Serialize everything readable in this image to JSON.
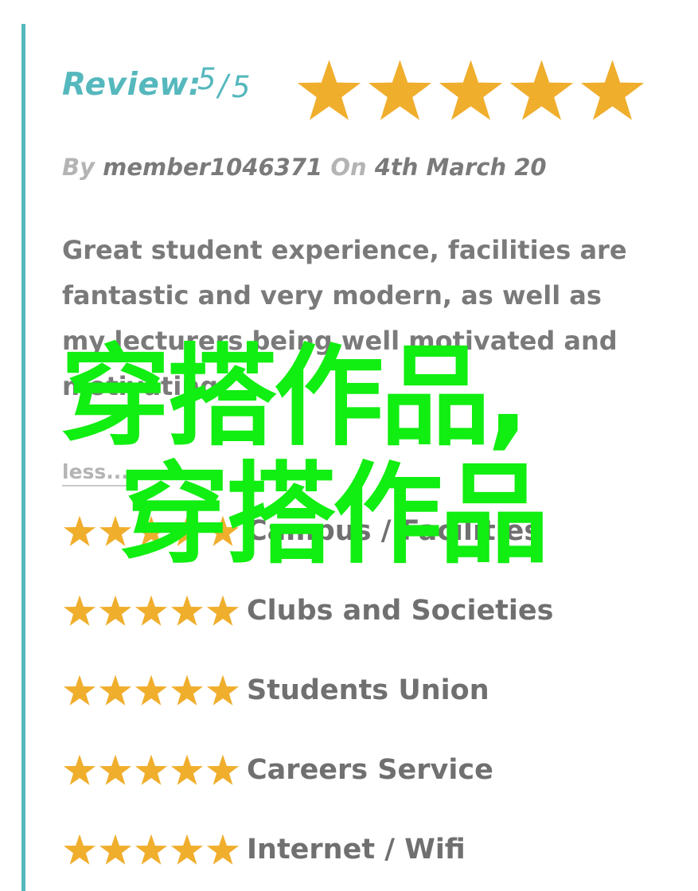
{
  "review": {
    "label": "Review:",
    "score": "5",
    "separator": "/",
    "total": "5",
    "stars_filled": 5,
    "star_color": "#f0ae2d",
    "accent_color": "#55b8bd"
  },
  "byline": {
    "by_label": "By",
    "author": "member1046371",
    "on_label": "On",
    "date": "4th March 20"
  },
  "body": {
    "text": "Great student experience, facilities are fantastic and very modern, as well as my lecturers being well motivated and motivating",
    "less_link": "less..."
  },
  "ratings": [
    {
      "label": "Campus / Facilities",
      "stars": 5
    },
    {
      "label": "Clubs and Societies",
      "stars": 5
    },
    {
      "label": "Students Union",
      "stars": 5
    },
    {
      "label": "Careers Service",
      "stars": 5
    },
    {
      "label": "Internet / Wifi",
      "stars": 5
    }
  ],
  "watermark": {
    "line1": "穿搭作品,",
    "line2": "穿搭作品",
    "color": "#11ee11"
  },
  "icons": {
    "star": "star-icon"
  }
}
